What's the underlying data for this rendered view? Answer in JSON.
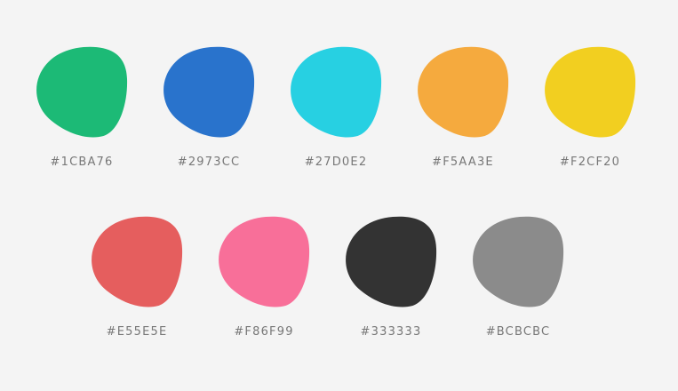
{
  "palette": {
    "rows": [
      {
        "swatches": [
          {
            "label": "#1CBA76",
            "color": "#1CBA76"
          },
          {
            "label": "#2973CC",
            "color": "#2973CC"
          },
          {
            "label": "#27D0E2",
            "color": "#27D0E2"
          },
          {
            "label": "#F5AA3E",
            "color": "#F5AA3E"
          },
          {
            "label": "#F2CF20",
            "color": "#F2CF20"
          }
        ]
      },
      {
        "swatches": [
          {
            "label": "#E55E5E",
            "color": "#E55E5E"
          },
          {
            "label": "#F86F99",
            "color": "#F86F99"
          },
          {
            "label": "#333333",
            "color": "#333333"
          },
          {
            "label": "#BCBCBC",
            "color": "#8B8B8B"
          }
        ]
      }
    ]
  }
}
